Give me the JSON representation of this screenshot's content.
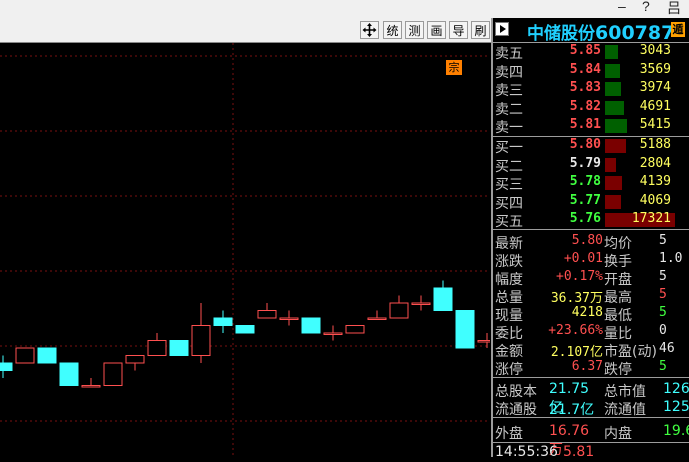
{
  "window_controls": {
    "minimize": "–",
    "restore": "?",
    "close": "吕"
  },
  "toolbar": {
    "move_icon": "move-icon",
    "buttons": [
      {
        "name": "tongji",
        "label": "统"
      },
      {
        "name": "celiang",
        "label": "测"
      },
      {
        "name": "huamian",
        "label": "画"
      },
      {
        "name": "daochu",
        "label": "导"
      },
      {
        "name": "shuaxin",
        "label": "刷"
      }
    ]
  },
  "chart": {
    "marker_label": "宗",
    "up_color": "#ff5050",
    "down_color": "#40ffff",
    "candles": [
      {
        "open": 5.74,
        "close": 5.73,
        "high": 5.75,
        "low": 5.72
      },
      {
        "open": 5.74,
        "close": 5.76,
        "high": 5.76,
        "low": 5.74
      },
      {
        "open": 5.76,
        "close": 5.74,
        "high": 5.76,
        "low": 5.74
      },
      {
        "open": 5.74,
        "close": 5.71,
        "high": 5.74,
        "low": 5.71
      },
      {
        "open": 5.71,
        "close": 5.71,
        "high": 5.72,
        "low": 5.71
      },
      {
        "open": 5.71,
        "close": 5.74,
        "high": 5.74,
        "low": 5.71
      },
      {
        "open": 5.74,
        "close": 5.75,
        "high": 5.75,
        "low": 5.73
      },
      {
        "open": 5.75,
        "close": 5.77,
        "high": 5.78,
        "low": 5.75
      },
      {
        "open": 5.77,
        "close": 5.75,
        "high": 5.77,
        "low": 5.75
      },
      {
        "open": 5.75,
        "close": 5.79,
        "high": 5.82,
        "low": 5.74
      },
      {
        "open": 5.8,
        "close": 5.79,
        "high": 5.81,
        "low": 5.78
      },
      {
        "open": 5.79,
        "close": 5.78,
        "high": 5.79,
        "low": 5.78
      },
      {
        "open": 5.8,
        "close": 5.81,
        "high": 5.82,
        "low": 5.8
      },
      {
        "open": 5.8,
        "close": 5.8,
        "high": 5.81,
        "low": 5.79
      },
      {
        "open": 5.8,
        "close": 5.78,
        "high": 5.8,
        "low": 5.78
      },
      {
        "open": 5.78,
        "close": 5.78,
        "high": 5.79,
        "low": 5.77
      },
      {
        "open": 5.78,
        "close": 5.79,
        "high": 5.79,
        "low": 5.78
      },
      {
        "open": 5.8,
        "close": 5.8,
        "high": 5.81,
        "low": 5.8
      },
      {
        "open": 5.8,
        "close": 5.82,
        "high": 5.83,
        "low": 5.8
      },
      {
        "open": 5.82,
        "close": 5.82,
        "high": 5.83,
        "low": 5.81
      },
      {
        "open": 5.84,
        "close": 5.81,
        "high": 5.85,
        "low": 5.81
      },
      {
        "open": 5.81,
        "close": 5.76,
        "high": 5.81,
        "low": 5.76
      },
      {
        "open": 5.77,
        "close": 5.77,
        "high": 5.78,
        "low": 5.76
      }
    ]
  },
  "stock": {
    "name": "中储股份",
    "code": "600787",
    "badge": "遁"
  },
  "order_book": {
    "asks": [
      {
        "label": "卖五",
        "price": "5.85",
        "volume": "3043",
        "level": 0.18
      },
      {
        "label": "卖四",
        "price": "5.84",
        "volume": "3569",
        "level": 0.21
      },
      {
        "label": "卖三",
        "price": "5.83",
        "volume": "3974",
        "level": 0.23
      },
      {
        "label": "卖二",
        "price": "5.82",
        "volume": "4691",
        "level": 0.27
      },
      {
        "label": "卖一",
        "price": "5.81",
        "volume": "5415",
        "level": 0.31
      }
    ],
    "bids": [
      {
        "label": "买一",
        "price": "5.80",
        "volume": "5188",
        "level": 0.3
      },
      {
        "label": "买二",
        "price": "5.79",
        "volume": "2804",
        "level": 0.16
      },
      {
        "label": "买三",
        "price": "5.78",
        "volume": "4139",
        "level": 0.24
      },
      {
        "label": "买四",
        "price": "5.77",
        "volume": "4069",
        "level": 0.23
      },
      {
        "label": "买五",
        "price": "5.76",
        "volume": "17321",
        "level": 1.0
      }
    ],
    "ask_color": "#006000",
    "bid_color": "#7a0000"
  },
  "quote": {
    "rows": [
      {
        "l1": "最新",
        "v1": "5.80",
        "c1": "up",
        "l2": "均价",
        "v2": "5",
        "c2": "wt"
      },
      {
        "l1": "涨跌",
        "v1": "+0.01",
        "c1": "up",
        "l2": "换手",
        "v2": "1.0",
        "c2": "wt"
      },
      {
        "l1": "幅度",
        "v1": "+0.17%",
        "c1": "up",
        "l2": "开盘",
        "v2": "5",
        "c2": "wt"
      },
      {
        "l1": "总量",
        "v1": "36.37万",
        "c1": "yel",
        "l2": "最高",
        "v2": "5",
        "c2": "up"
      },
      {
        "l1": "现量",
        "v1": "4218",
        "c1": "yel",
        "l2": "最低",
        "v2": "5",
        "c2": "dn"
      },
      {
        "l1": "委比",
        "v1": "+23.66%",
        "c1": "up",
        "l2": "量比",
        "v2": "0",
        "c2": "wt"
      },
      {
        "l1": "金额",
        "v1": "2.107亿",
        "c1": "yel",
        "l2": "市盈(动)",
        "v2": "46",
        "c2": "wt"
      },
      {
        "l1": "涨停",
        "v1": "6.37",
        "c1": "up",
        "l2": "跌停",
        "v2": "5",
        "c2": "dn"
      }
    ]
  },
  "shares": {
    "rows": [
      {
        "l1": "总股本",
        "v1": "21.75亿",
        "l2": "总市值",
        "v2": "126."
      },
      {
        "l1": "流通股",
        "v1": "21.7亿",
        "l2": "流通值",
        "v2": "125."
      }
    ]
  },
  "trade_side": {
    "l1": "外盘",
    "v1": "16.76万",
    "l2": "内盘",
    "v2": "19.6"
  },
  "tick": {
    "time": "14:55:36",
    "price": "5.81"
  }
}
